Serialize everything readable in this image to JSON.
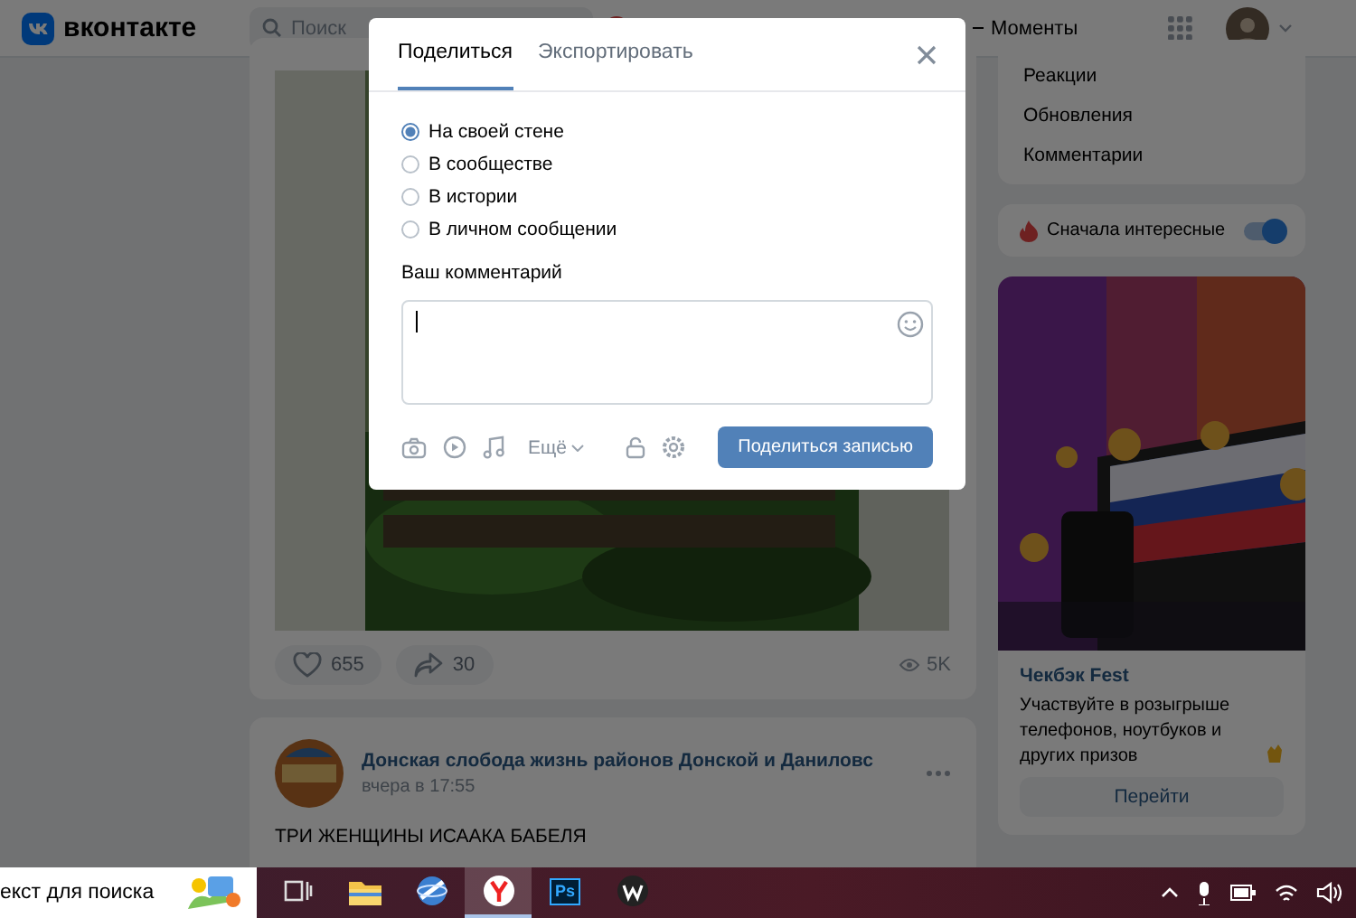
{
  "header": {
    "logo_text": "вконтакте",
    "search_placeholder": "Поиск",
    "moments_label": "Моменты"
  },
  "post": {
    "likes": "655",
    "shares": "30",
    "views": "5K"
  },
  "post2": {
    "author": "Донская слобода жизнь районов Донской и Даниловс",
    "time": "вчера в 17:55",
    "text": "ТРИ ЖЕНЩИНЫ ИСААКА БАБЕЛЯ"
  },
  "sidebar": {
    "items": [
      {
        "label": "Реакции"
      },
      {
        "label": "Обновления"
      },
      {
        "label": "Комментарии"
      }
    ],
    "toggle": {
      "label": "Сначала интересные",
      "on": true
    }
  },
  "ad": {
    "kind": "picture",
    "title": "Чекбэк Fest",
    "text": "Участвуйте в розыгрыше телефонов, ноутбуков и других призов",
    "button": "Перейти"
  },
  "modal": {
    "tabs": [
      {
        "label": "Поделиться",
        "selected": true
      },
      {
        "label": "Экспортировать",
        "selected": false
      }
    ],
    "options": [
      {
        "label": "На своей стене",
        "selected": true
      },
      {
        "label": "В сообществе",
        "selected": false
      },
      {
        "label": "В истории",
        "selected": false
      },
      {
        "label": "В личном сообщении",
        "selected": false
      }
    ],
    "comment_label": "Ваш комментарий",
    "more_label": "Ещё",
    "submit": "Поделиться записью"
  },
  "taskbar": {
    "search_text": "екст для поиска",
    "apps": [
      {
        "kind": "taskview",
        "active": false
      },
      {
        "kind": "folder",
        "active": false
      },
      {
        "kind": "globe",
        "active": false
      },
      {
        "kind": "yandex",
        "active": true
      },
      {
        "kind": "ps",
        "label": "Ps",
        "active": false
      },
      {
        "kind": "dark",
        "active": false
      }
    ]
  }
}
